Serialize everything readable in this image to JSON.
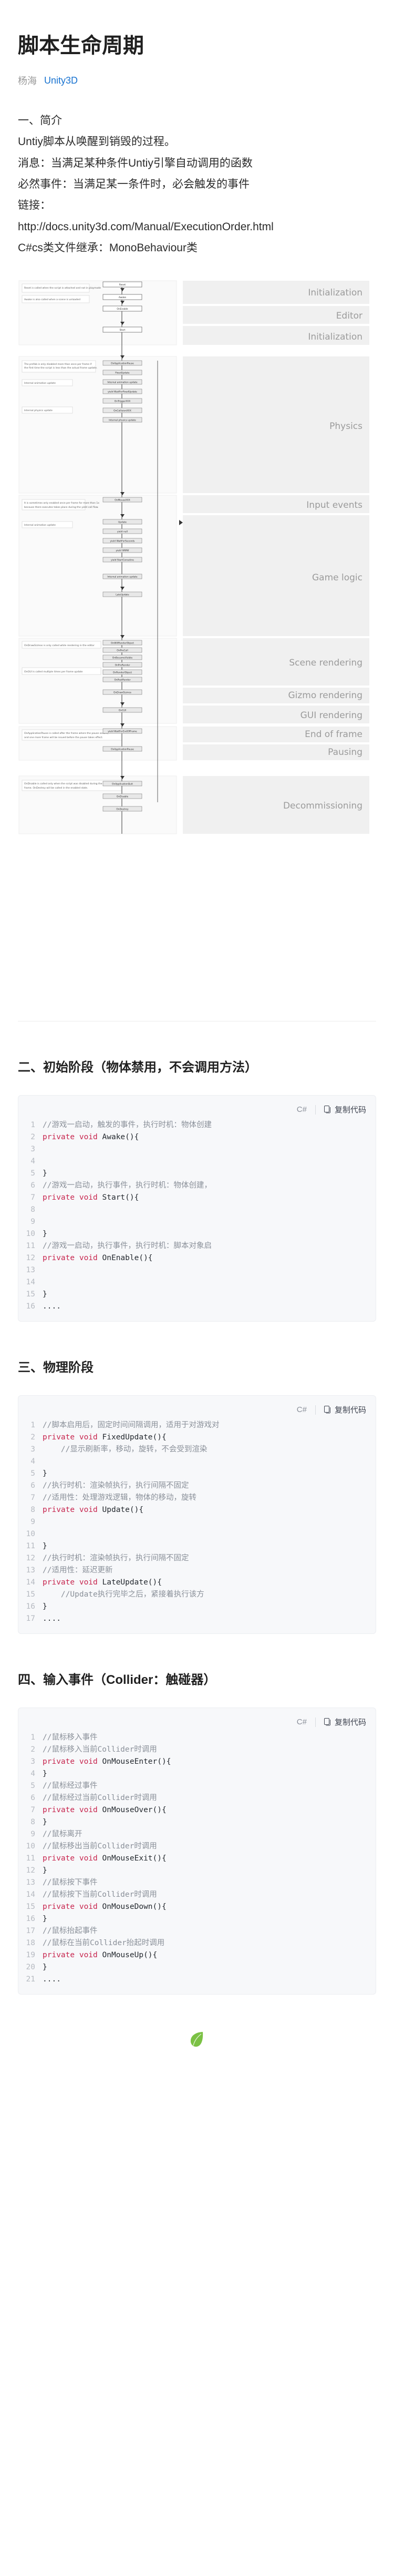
{
  "article": {
    "title": "脚本生命周期",
    "author": "杨海",
    "tag": "Unity3D"
  },
  "intro": {
    "heading": "一、简介",
    "lines": [
      "一、简介",
      "Untiy脚本从唤醒到销毁的过程。",
      "消息：当满足某种条件Untiy引擎自动调用的函数",
      "必然事件：当满足某一条件时，必会触发的事件",
      "链接：",
      "http://docs.unity3d.com/Manual/ExecutionOrder.html",
      "C#cs类文件继承：MonoBehaviour类"
    ]
  },
  "flowchart": {
    "alt": "Unity 脚本生命周期执行顺序流程图",
    "phase_labels": [
      "Initialization",
      "Editor",
      "Initialization",
      "Physics",
      "Input events",
      "Game logic",
      "Scene rendering",
      "Gizmo rendering",
      "GUI rendering",
      "End of frame",
      "Pausing",
      "Decommissioning"
    ],
    "notes": [
      "Reset is called when the script is attached and not in playmode",
      "Awake is also called when a scene is unloaded",
      "The prefab is only disabled more than once per frame if the first time the script is less than the actual frame update happens.",
      "Internal animation update",
      "Internal physics update",
      "Physics update loop runs at fixed timestep",
      "Internal input update",
      "Internal rendering update",
      "OnDrawGizmos is only called while rendering in the editor",
      "OnGUI is called multiple times per frame update",
      "OnApplicationPause is called after the frame where the pause occurs, and one more frame will be issued before the pause actually takes effect",
      "OnDisable is called only when the script was disabled during the frame. OnDestroy will be called in the enabled state."
    ],
    "nodes": [
      "Reset",
      "Awake",
      "OnEnable",
      "Start",
      "OnApplicationPause",
      "FixedUpdate",
      "Internal animation update",
      "OnTriggerXXX",
      "OnCollisionXXX",
      "yield WaitForFixedUpdate",
      "OnMouseXXX",
      "Update",
      "yield null",
      "yield WaitForSeconds",
      "yield WWW",
      "yield StartCoroutine",
      "Internal animation update",
      "LateUpdate",
      "OnWillRenderObject",
      "OnPreCull",
      "OnBecameVisible/OnBecameInvisible",
      "OnPreRender",
      "OnRenderObject",
      "OnPostRender",
      "OnRenderImage",
      "OnDrawGizmos",
      "OnGUI",
      "yield WaitForEndOfFrame",
      "OnApplicationQuit",
      "OnDisable",
      "OnDestroy"
    ]
  },
  "sections": [
    {
      "heading": "二、初始阶段（物体禁用，不会调用方法）",
      "code": {
        "lang": "C#",
        "copy_label": "复制代码",
        "lines": [
          {
            "n": "1",
            "parts": [
              {
                "t": "//游戏一启动，触发的事件，执行时机：物体创建",
                "c": "cm"
              }
            ]
          },
          {
            "n": "2",
            "parts": [
              {
                "t": "private void ",
                "c": "kw"
              },
              {
                "t": "Awake(){",
                "c": ""
              }
            ]
          },
          {
            "n": "3",
            "parts": [
              {
                "t": "",
                "c": ""
              }
            ]
          },
          {
            "n": "4",
            "parts": [
              {
                "t": "",
                "c": ""
              }
            ]
          },
          {
            "n": "5",
            "parts": [
              {
                "t": "}",
                "c": ""
              }
            ]
          },
          {
            "n": "6",
            "parts": [
              {
                "t": "//游戏一启动，执行事件，执行时机：物体创建，",
                "c": "cm"
              }
            ]
          },
          {
            "n": "7",
            "parts": [
              {
                "t": "private void ",
                "c": "kw"
              },
              {
                "t": "Start(){",
                "c": ""
              }
            ]
          },
          {
            "n": "8",
            "parts": [
              {
                "t": "",
                "c": ""
              }
            ]
          },
          {
            "n": "9",
            "parts": [
              {
                "t": "",
                "c": ""
              }
            ]
          },
          {
            "n": "10",
            "parts": [
              {
                "t": "}",
                "c": ""
              }
            ]
          },
          {
            "n": "11",
            "parts": [
              {
                "t": "//游戏一启动，执行事件，执行时机：脚本对象启",
                "c": "cm"
              }
            ]
          },
          {
            "n": "12",
            "parts": [
              {
                "t": "private void ",
                "c": "kw"
              },
              {
                "t": "OnEnable(){",
                "c": ""
              }
            ]
          },
          {
            "n": "13",
            "parts": [
              {
                "t": "",
                "c": ""
              }
            ]
          },
          {
            "n": "14",
            "parts": [
              {
                "t": "",
                "c": ""
              }
            ]
          },
          {
            "n": "15",
            "parts": [
              {
                "t": "}",
                "c": ""
              }
            ]
          },
          {
            "n": "16",
            "parts": [
              {
                "t": "....",
                "c": ""
              }
            ]
          }
        ]
      }
    },
    {
      "heading": "三、物理阶段",
      "code": {
        "lang": "C#",
        "copy_label": "复制代码",
        "lines": [
          {
            "n": "1",
            "parts": [
              {
                "t": "//脚本启用后，固定时间间隔调用，适用于对游戏对",
                "c": "cm"
              }
            ]
          },
          {
            "n": "2",
            "parts": [
              {
                "t": "private void ",
                "c": "kw"
              },
              {
                "t": "FixedUpdate(){",
                "c": ""
              }
            ]
          },
          {
            "n": "3",
            "parts": [
              {
                "t": "    //显示刷新率，移动，旋转，不会受到渲染",
                "c": "cm"
              }
            ]
          },
          {
            "n": "4",
            "parts": [
              {
                "t": "",
                "c": ""
              }
            ]
          },
          {
            "n": "5",
            "parts": [
              {
                "t": "}",
                "c": ""
              }
            ]
          },
          {
            "n": "6",
            "parts": [
              {
                "t": "//执行时机：渲染帧执行，执行间隔不固定",
                "c": "cm"
              }
            ]
          },
          {
            "n": "7",
            "parts": [
              {
                "t": "//适用性：处理游戏逻辑，物体的移动，旋转",
                "c": "cm"
              }
            ]
          },
          {
            "n": "8",
            "parts": [
              {
                "t": "private void ",
                "c": "kw"
              },
              {
                "t": "Update(){",
                "c": ""
              }
            ]
          },
          {
            "n": "9",
            "parts": [
              {
                "t": "",
                "c": ""
              }
            ]
          },
          {
            "n": "10",
            "parts": [
              {
                "t": "",
                "c": ""
              }
            ]
          },
          {
            "n": "11",
            "parts": [
              {
                "t": "}",
                "c": ""
              }
            ]
          },
          {
            "n": "12",
            "parts": [
              {
                "t": "//执行时机：渲染帧执行，执行间隔不固定",
                "c": "cm"
              }
            ]
          },
          {
            "n": "13",
            "parts": [
              {
                "t": "//适用性：延迟更新",
                "c": "cm"
              }
            ]
          },
          {
            "n": "14",
            "parts": [
              {
                "t": "private void ",
                "c": "kw"
              },
              {
                "t": "LateUpdate(){",
                "c": ""
              }
            ]
          },
          {
            "n": "15",
            "parts": [
              {
                "t": "    //Update执行完毕之后，紧接着执行该方",
                "c": "cm"
              }
            ]
          },
          {
            "n": "16",
            "parts": [
              {
                "t": "}",
                "c": ""
              }
            ]
          },
          {
            "n": "17",
            "parts": [
              {
                "t": "....",
                "c": ""
              }
            ]
          }
        ]
      }
    },
    {
      "heading": "四、输入事件（Collider：触碰器）",
      "code": {
        "lang": "C#",
        "copy_label": "复制代码",
        "lines": [
          {
            "n": "1",
            "parts": [
              {
                "t": "//鼠标移入事件",
                "c": "cm"
              }
            ]
          },
          {
            "n": "2",
            "parts": [
              {
                "t": "//鼠标移入当前Collider时调用",
                "c": "cm"
              }
            ]
          },
          {
            "n": "3",
            "parts": [
              {
                "t": "private void ",
                "c": "kw"
              },
              {
                "t": "OnMouseEnter(){",
                "c": ""
              }
            ]
          },
          {
            "n": "4",
            "parts": [
              {
                "t": "}",
                "c": ""
              }
            ]
          },
          {
            "n": "5",
            "parts": [
              {
                "t": "//鼠标经过事件",
                "c": "cm"
              }
            ]
          },
          {
            "n": "6",
            "parts": [
              {
                "t": "//鼠标经过当前Collider时调用",
                "c": "cm"
              }
            ]
          },
          {
            "n": "7",
            "parts": [
              {
                "t": "private void ",
                "c": "kw"
              },
              {
                "t": "OnMouseOver(){",
                "c": ""
              }
            ]
          },
          {
            "n": "8",
            "parts": [
              {
                "t": "}",
                "c": ""
              }
            ]
          },
          {
            "n": "9",
            "parts": [
              {
                "t": "//鼠标离开",
                "c": "cm"
              }
            ]
          },
          {
            "n": "10",
            "parts": [
              {
                "t": "//鼠标移出当前Collider时调用",
                "c": "cm"
              }
            ]
          },
          {
            "n": "11",
            "parts": [
              {
                "t": "private void ",
                "c": "kw"
              },
              {
                "t": "OnMouseExit(){",
                "c": ""
              }
            ]
          },
          {
            "n": "12",
            "parts": [
              {
                "t": "}",
                "c": ""
              }
            ]
          },
          {
            "n": "13",
            "parts": [
              {
                "t": "//鼠标按下事件",
                "c": "cm"
              }
            ]
          },
          {
            "n": "14",
            "parts": [
              {
                "t": "//鼠标按下当前Collider时调用",
                "c": "cm"
              }
            ]
          },
          {
            "n": "15",
            "parts": [
              {
                "t": "private void ",
                "c": "kw"
              },
              {
                "t": "OnMouseDown(){",
                "c": ""
              }
            ]
          },
          {
            "n": "16",
            "parts": [
              {
                "t": "}",
                "c": ""
              }
            ]
          },
          {
            "n": "17",
            "parts": [
              {
                "t": "//鼠标抬起事件",
                "c": "cm"
              }
            ]
          },
          {
            "n": "18",
            "parts": [
              {
                "t": "//鼠标在当前Collider抬起时调用",
                "c": "cm"
              }
            ]
          },
          {
            "n": "19",
            "parts": [
              {
                "t": "private void ",
                "c": "kw"
              },
              {
                "t": "OnMouseUp(){",
                "c": ""
              }
            ]
          },
          {
            "n": "20",
            "parts": [
              {
                "t": "}",
                "c": ""
              }
            ]
          },
          {
            "n": "21",
            "parts": [
              {
                "t": "....",
                "c": ""
              }
            ]
          }
        ]
      }
    }
  ],
  "colors": {
    "accent": "#1772d0",
    "keyword": "#c7254e",
    "comment": "#8a9099",
    "code_bg": "#f7f8fa",
    "line_number": "#b6bac1",
    "phase_label": "#9b9b9b",
    "phase_bg": "#f0f0f0",
    "leaf": "#7bc144"
  },
  "footer": {
    "icon": "leaf-icon"
  }
}
